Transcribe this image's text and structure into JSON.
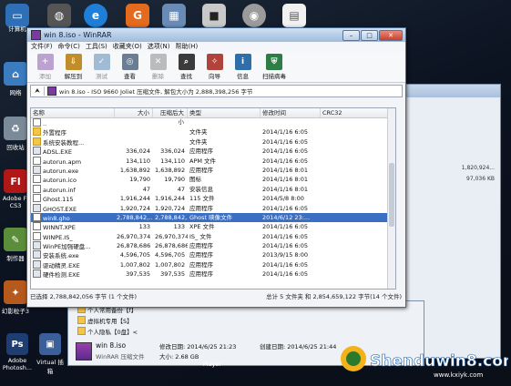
{
  "desktop": {
    "left_icons": [
      "计算机",
      "网络",
      "回收站",
      "Adobe Fl CS3",
      "制作器",
      "幻影粒子3"
    ],
    "bottom_icons": [
      "Adobe Photosh...",
      "Virtual 插箱",
      "Player"
    ]
  },
  "winrar": {
    "title": "win 8.iso - WinRAR",
    "menu": [
      "文件(F)",
      "命令(C)",
      "工具(S)",
      "收藏夹(O)",
      "选项(N)",
      "帮助(H)"
    ],
    "toolbar": [
      {
        "label": "添加",
        "icon": "add-icon",
        "enabled": false
      },
      {
        "label": "解压到",
        "icon": "extract-icon",
        "enabled": true
      },
      {
        "label": "测试",
        "icon": "test-icon",
        "enabled": false
      },
      {
        "label": "查看",
        "icon": "view-icon",
        "enabled": true
      },
      {
        "label": "删除",
        "icon": "delete-icon",
        "enabled": false
      },
      {
        "label": "查找",
        "icon": "find-icon",
        "enabled": true
      },
      {
        "label": "向导",
        "icon": "wizard-icon",
        "enabled": true
      },
      {
        "label": "信息",
        "icon": "info-icon",
        "enabled": true
      },
      {
        "label": "扫描病毒",
        "icon": "virus-scan-icon",
        "enabled": true
      }
    ],
    "address": "win 8.iso - ISO 9660 Joliet 压缩文件, 解包大小为 2,888,398,256 字节",
    "columns": [
      "名称",
      "大小",
      "压缩后大小",
      "类型",
      "修改时间",
      "CRC32"
    ],
    "files": [
      {
        "name": "..",
        "size": "",
        "packed": "",
        "type": "",
        "date": "",
        "kind": "up"
      },
      {
        "name": "外置程序",
        "size": "",
        "packed": "",
        "type": "文件夹",
        "date": "2014/1/16 6:05",
        "kind": "folder"
      },
      {
        "name": "系统安装教程...",
        "size": "",
        "packed": "",
        "type": "文件夹",
        "date": "2014/1/16 6:05",
        "kind": "folder"
      },
      {
        "name": "ADSL.EXE",
        "size": "336,024",
        "packed": "336,024",
        "type": "应用程序",
        "date": "2014/1/16 6:05",
        "kind": "exe"
      },
      {
        "name": "autorun.apm",
        "size": "134,110",
        "packed": "134,110",
        "type": "APM 文件",
        "date": "2014/1/16 6:05",
        "kind": "file"
      },
      {
        "name": "autorun.exe",
        "size": "1,638,892",
        "packed": "1,638,892",
        "type": "应用程序",
        "date": "2014/1/16 8:01",
        "kind": "exe"
      },
      {
        "name": "autorun.ico",
        "size": "19,790",
        "packed": "19,790",
        "type": "图标",
        "date": "2014/1/16 8:01",
        "kind": "file"
      },
      {
        "name": "autorun.inf",
        "size": "47",
        "packed": "47",
        "type": "安装信息",
        "date": "2014/1/16 8:01",
        "kind": "file"
      },
      {
        "name": "Ghost.115",
        "size": "1,916,244",
        "packed": "1,916,244",
        "type": "115 文件",
        "date": "2014/5/8 8:00",
        "kind": "file"
      },
      {
        "name": "GHOST.EXE",
        "size": "1,920,724",
        "packed": "1,920,724",
        "type": "应用程序",
        "date": "2014/1/16 6:05",
        "kind": "exe"
      },
      {
        "name": "win8.gho",
        "size": "2,788,842,...",
        "packed": "2,788,842,...",
        "type": "Ghost 映像文件",
        "date": "2014/6/12 23:...",
        "kind": "file"
      },
      {
        "name": "WINNT.XPE",
        "size": "133",
        "packed": "133",
        "type": "XPE 文件",
        "date": "2014/1/16 6:05",
        "kind": "file"
      },
      {
        "name": "WINPE.IS_",
        "size": "26,970,374",
        "packed": "26,970,374",
        "type": "IS_ 文件",
        "date": "2014/1/16 6:05",
        "kind": "file"
      },
      {
        "name": "WinPE加强硬盘...",
        "size": "26,878,686",
        "packed": "26,878,686",
        "type": "应用程序",
        "date": "2014/1/16 6:05",
        "kind": "exe"
      },
      {
        "name": "安装系统.exe",
        "size": "4,596,705",
        "packed": "4,596,705",
        "type": "应用程序",
        "date": "2013/9/15 8:00",
        "kind": "exe"
      },
      {
        "name": "驱动精灵.EXE",
        "size": "1,007,802",
        "packed": "1,007,802",
        "type": "应用程序",
        "date": "2014/1/16 6:05",
        "kind": "exe"
      },
      {
        "name": "硬件检测.EXE",
        "size": "397,535",
        "packed": "397,535",
        "type": "应用程序",
        "date": "2014/1/16 6:05",
        "kind": "exe"
      }
    ],
    "selected_index": 10,
    "status_left": "已选择 2,788,842,056 字节 (1 个文件)",
    "status_right": "总计 5 文件夹 和 2,854,659,122 字节(14 个文件)"
  },
  "background_window": {
    "values": [
      "1,820,924...",
      "97,036 KB"
    ]
  },
  "bottom_panel": {
    "items": [
      "个人常用备份【f】",
      "虚拟机专用【S】",
      "个人隐私【0盘】<"
    ],
    "file_name": "win 8.iso",
    "file_type": "WinRAR 压缩文件",
    "modified_label": "修改日期: 2014/6/25 21:23",
    "size_label": "大小: 2.68 GB",
    "created_label": "创建日期: 2014/6/25 21:44"
  },
  "watermark": {
    "main": "Shenduwin8.com",
    "sub": "www.kxiyk.com"
  },
  "colors": {
    "selection": "#3a6fc3",
    "title_bar": "#9fbbdd",
    "folder": "#f2c64a"
  }
}
